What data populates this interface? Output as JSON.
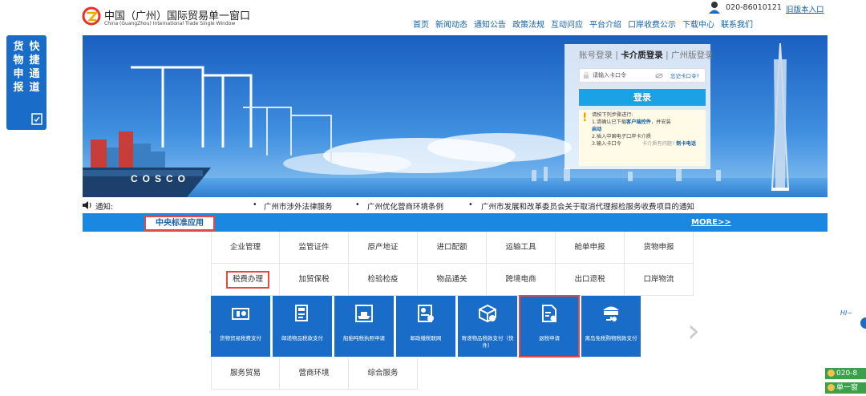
{
  "header": {
    "site_cn": "中国（广州）国际贸易单一窗口",
    "site_en": "China (GuangZhou) International Trade Single Window",
    "phone": "020-86010121",
    "old_version_link": "旧版本入口",
    "nav": [
      "首页",
      "新闻动态",
      "通知公告",
      "政策法规",
      "互动问应",
      "平台介绍",
      "口岸收费公示",
      "下载中心",
      "联系我们"
    ]
  },
  "side_float": {
    "col1": "快捷通道",
    "col2": "货物申报"
  },
  "login": {
    "tabs": [
      "账号登录",
      "卡介质登录",
      "广州版登录"
    ],
    "active_tab": "卡介质登录",
    "separator": "|",
    "input_placeholder": "请输入卡口令",
    "forgot_link": "忘记卡口令?",
    "login_button": "登录",
    "tips": {
      "intro": "请按下列步骤进行:",
      "step1_a": "1.请确认已下载",
      "step1_link": "客户端控件",
      "step1_b": "，并安装",
      "step1_c": "启动",
      "step2": "2.插入中国电子口岸卡介质",
      "step3": "3.输入卡口令",
      "question": "卡介质有问题?",
      "hotline": "制卡电话"
    }
  },
  "notice": {
    "label": "通知:",
    "bullet": "•",
    "items": [
      "广州市涉外法律服务",
      "广州优化营商环境条例",
      "广州市发展和改革委员会关于取消代理报检服务收费项目的通知"
    ]
  },
  "category_bar": {
    "active_tab": "中央标准应用",
    "more": "MORE>>"
  },
  "grid": {
    "row1": [
      "企业管理",
      "监管证件",
      "原产地证",
      "进口配额",
      "运输工具",
      "舱单申报",
      "货物申报"
    ],
    "row2": [
      "税费办理",
      "加贸保税",
      "检验检疫",
      "物品通关",
      "跨境电商",
      "出口退税",
      "口岸物流"
    ],
    "row3": [
      "服务贸易",
      "营商环境",
      "综合服务"
    ]
  },
  "tiles": [
    {
      "label": "货物贸易税费支付",
      "icon": "tax-payment-icon"
    },
    {
      "label": "邮递物品税款支付",
      "icon": "tax-form-icon"
    },
    {
      "label": "船舶吨税执照申请",
      "icon": "ship-icon"
    },
    {
      "label": "邮政缴税联网",
      "icon": "postal-icon"
    },
    {
      "label": "寄递物品税款支付（快件）",
      "icon": "parcel-icon"
    },
    {
      "label": "退税申请",
      "icon": "refund-doc-icon"
    },
    {
      "label": "离岛免税购物税款支付",
      "icon": "duty-free-icon"
    }
  ],
  "right_edge": {
    "hi": "HI~",
    "phone_partial": "020-8",
    "second_partial": "单一窗"
  },
  "colors": {
    "primary": "#1a87e0",
    "dark_blue": "#1a6cc9",
    "highlight_red": "#e24a4a",
    "green": "#3aa14a"
  }
}
